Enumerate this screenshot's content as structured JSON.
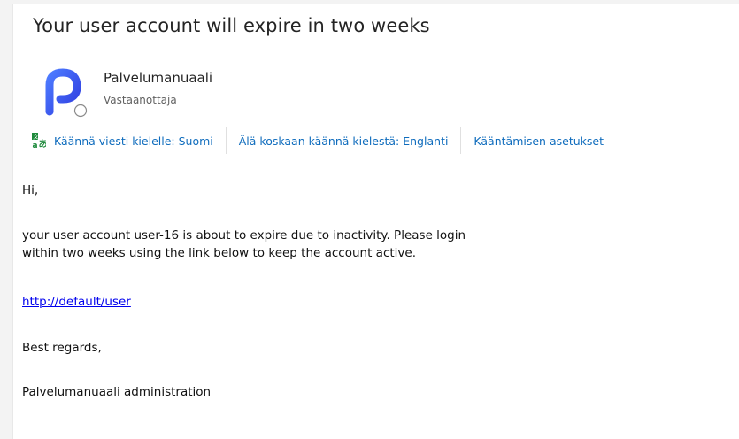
{
  "email": {
    "subject": "Your user account will expire in two weeks",
    "sender": {
      "name": "Palvelumanuaali",
      "recipient_label": "Vastaanottaja"
    },
    "translation_bar": {
      "translate_label": "Käännä viesti kielelle: Suomi",
      "never_translate_label": "Älä koskaan käännä kielestä: Englanti",
      "settings_label": "Kääntämisen asetukset"
    },
    "body": {
      "greeting": "Hi,",
      "line1": "your user account user-16 is about to expire due to inactivity. Please login",
      "line2": "within two weeks using the link below to keep the account active.",
      "link": "http://default/user",
      "closing": "Best regards,",
      "signature": "Palvelumanuaali administration"
    }
  },
  "colors": {
    "link_blue": "#0f6cbd",
    "hyperlink": "#0000ee",
    "avatar_blue": "#3b5bfd"
  }
}
